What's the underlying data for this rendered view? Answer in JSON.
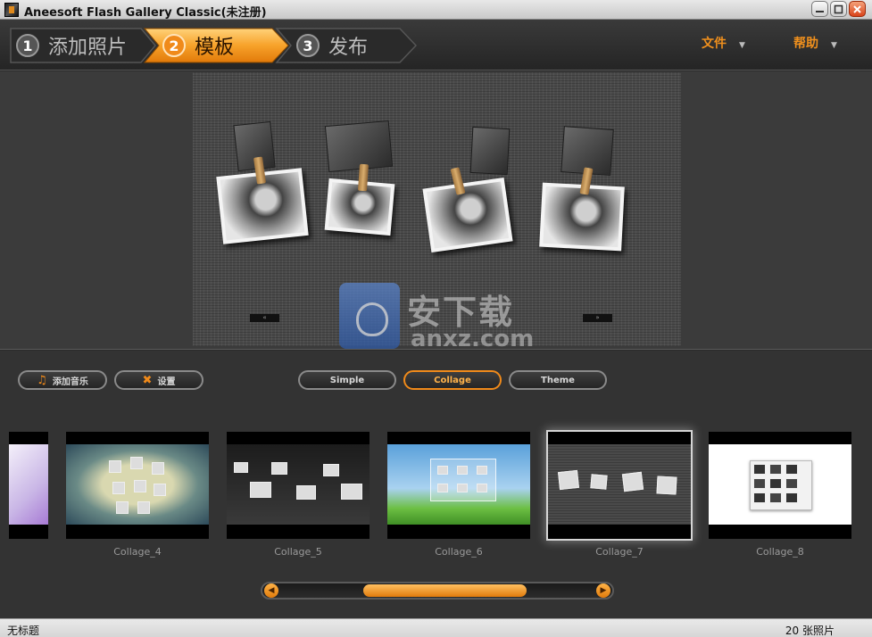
{
  "window": {
    "title": "Aneesoft Flash Gallery Classic(未注册)"
  },
  "steps": [
    {
      "num": "1",
      "label": "添加照片"
    },
    {
      "num": "2",
      "label": "模板"
    },
    {
      "num": "3",
      "label": "发布"
    }
  ],
  "menus": {
    "file": "文件",
    "help": "帮助"
  },
  "preview": {
    "prev_nav": "«",
    "next_nav": "»"
  },
  "watermark": {
    "main": "安下载",
    "sub": "anxz.com"
  },
  "buttons": {
    "add_music": "添加音乐",
    "settings": "设置"
  },
  "template_tabs": [
    {
      "label": "Simple",
      "active": false
    },
    {
      "label": "Collage",
      "active": true
    },
    {
      "label": "Theme",
      "active": false
    }
  ],
  "thumbnails": [
    {
      "label": "Collage_4"
    },
    {
      "label": "Collage_5"
    },
    {
      "label": "Collage_6"
    },
    {
      "label": "Collage_7",
      "selected": true
    },
    {
      "label": "Collage_8"
    }
  ],
  "scrollbar": {
    "position_fraction": 0.55
  },
  "status": {
    "left": "无标题",
    "right": "20 张照片"
  },
  "colors": {
    "accent": "#f08a1a",
    "background": "#333333"
  }
}
